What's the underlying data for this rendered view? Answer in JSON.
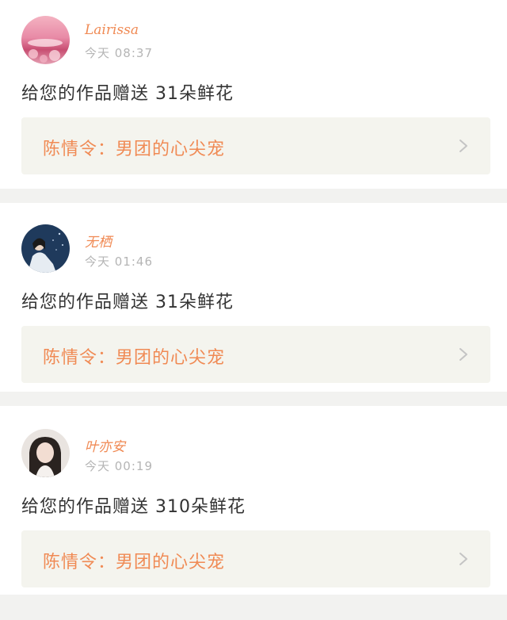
{
  "notifications": [
    {
      "username": "Lairissa",
      "timestamp": "今天 08:37",
      "message": "给您的作品赠送 31朵鲜花",
      "work_title": "陈情令：男团的心尖宠",
      "avatar": "pink-landscape-avatar"
    },
    {
      "username": "无栖",
      "timestamp": "今天 01:46",
      "message": "给您的作品赠送 31朵鲜花",
      "work_title": "陈情令：男团的心尖宠",
      "avatar": "white-robed-man-avatar"
    },
    {
      "username": "叶亦安",
      "timestamp": "今天 00:19",
      "message": "给您的作品赠送 310朵鲜花",
      "work_title": "陈情令：男团的心尖宠",
      "avatar": "woman-portrait-avatar"
    }
  ],
  "colors": {
    "accent": "#f08a54",
    "card_bg": "#ffffff",
    "link_bg": "#f4f4ee",
    "page_bg": "#f2f2f0",
    "muted": "#b5b5b5"
  }
}
